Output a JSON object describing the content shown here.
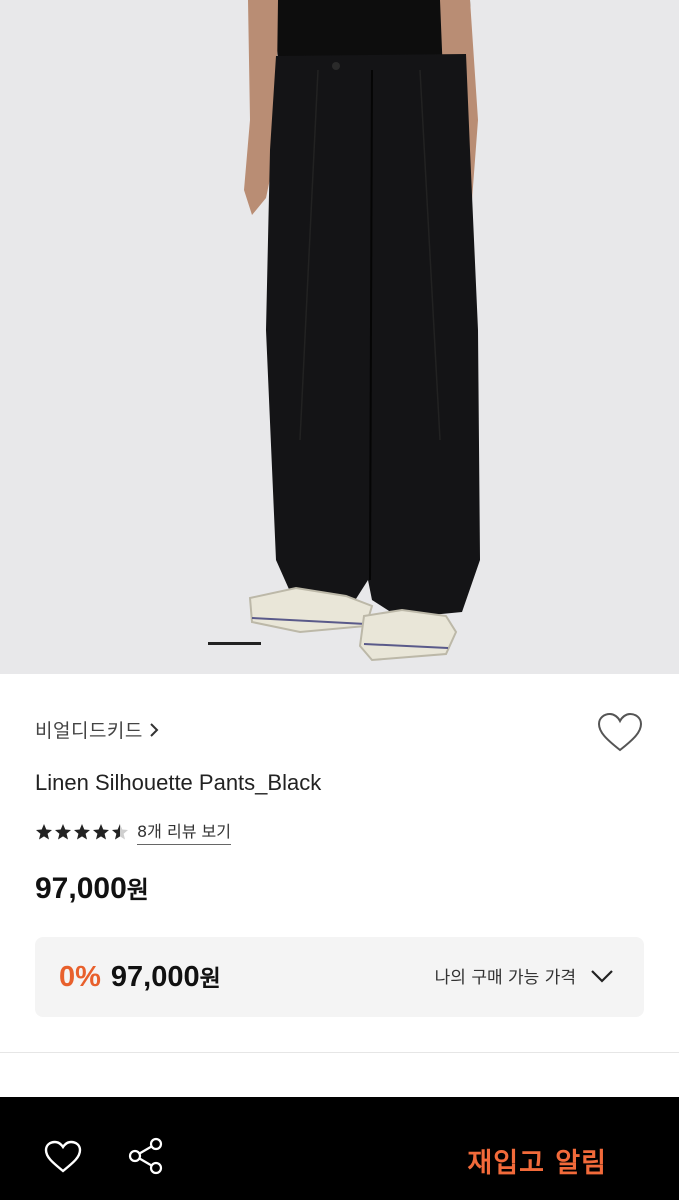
{
  "product": {
    "brand": "비얼디드키드",
    "title": "Linen Silhouette Pants_Black",
    "rating": 4.5,
    "rating_max": 5,
    "review_link": "8개 리뷰 보기",
    "price_number": "97,000",
    "price_unit": "원"
  },
  "price_box": {
    "discount_rate": "0%",
    "price_number": "97,000",
    "price_unit": "원",
    "my_price_label": "나의 구매 가능 가격"
  },
  "gallery": {
    "image_alt": "product-photo-black-wide-pants",
    "page_indicator_icon": "carousel-indicator"
  },
  "bottom_bar": {
    "wish_icon": "heart-outline-icon",
    "share_icon": "share-icon",
    "restock_label": "재입고 알림"
  },
  "colors": {
    "accent": "#f26a3a",
    "discount": "#e8602c",
    "bar_bg": "#000000",
    "photo_bg": "#e8e8ea"
  }
}
